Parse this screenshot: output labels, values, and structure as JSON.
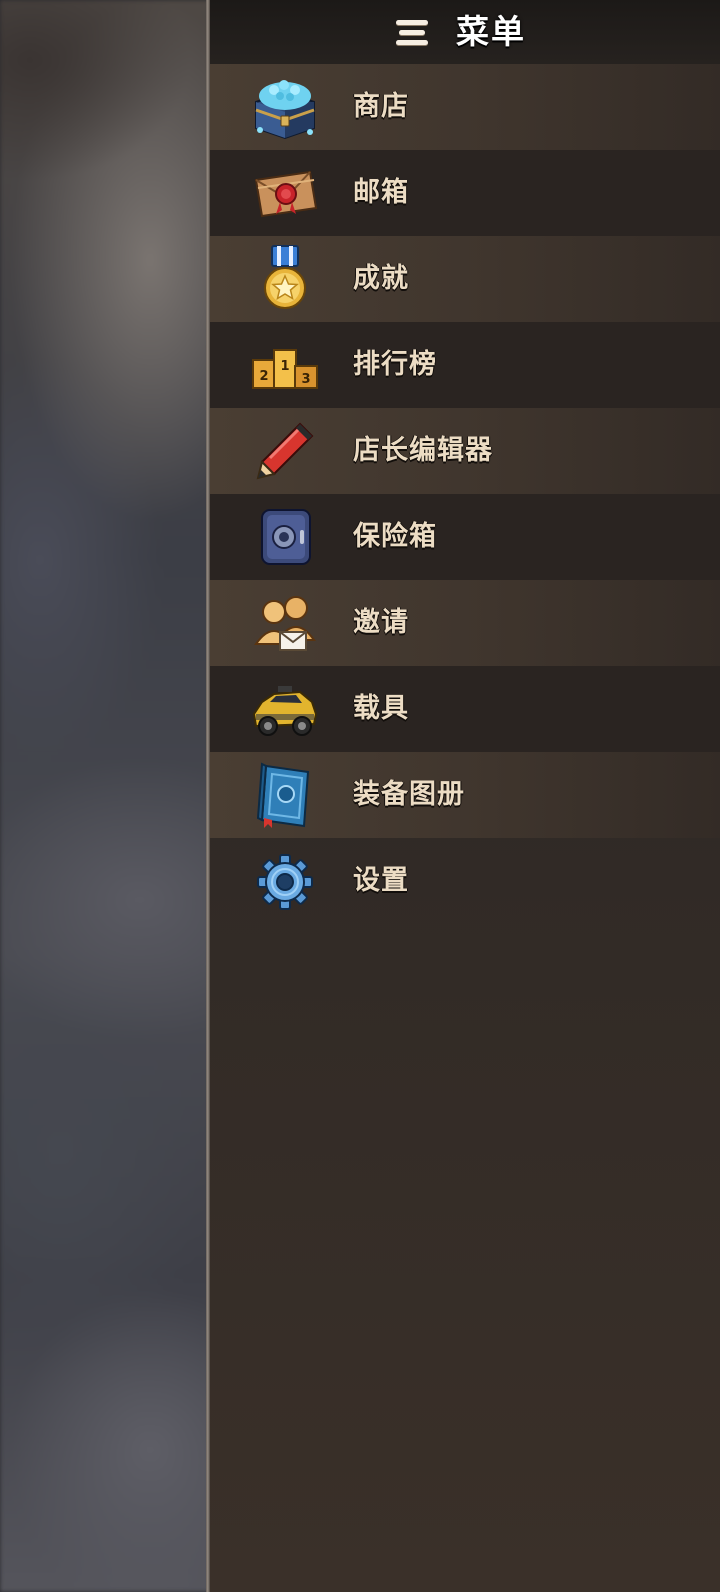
{
  "header": {
    "title": "菜单",
    "menu_icon": "hamburger-icon"
  },
  "menu": {
    "items": [
      {
        "label": "商店",
        "icon": "treasure-chest-icon"
      },
      {
        "label": "邮箱",
        "icon": "sealed-envelope-icon"
      },
      {
        "label": "成就",
        "icon": "medal-icon"
      },
      {
        "label": "排行榜",
        "icon": "podium-icon"
      },
      {
        "label": "店长编辑器",
        "icon": "pencil-icon"
      },
      {
        "label": "保险箱",
        "icon": "safe-icon"
      },
      {
        "label": "邀请",
        "icon": "invite-friends-icon"
      },
      {
        "label": "载具",
        "icon": "vehicle-icon"
      },
      {
        "label": "装备图册",
        "icon": "book-icon"
      },
      {
        "label": "设置",
        "icon": "gear-icon"
      }
    ]
  },
  "colors": {
    "panel_bg": "#2f2925",
    "row_light": "#4a3e33",
    "row_dark": "#2a2421",
    "label_text": "#ecdcc4",
    "title_text": "#ffffff"
  }
}
